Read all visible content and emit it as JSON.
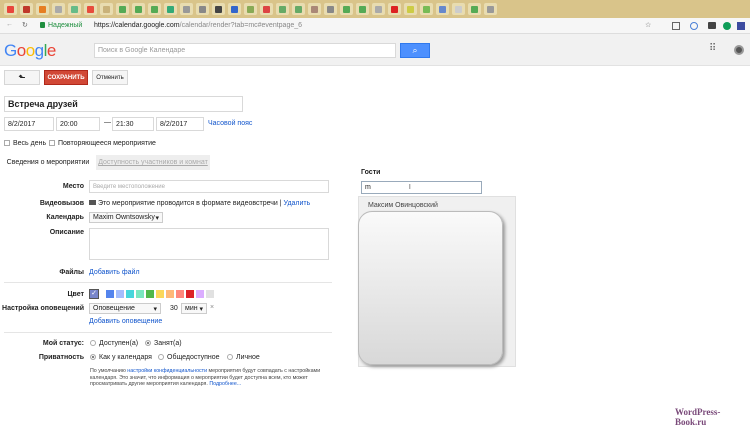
{
  "browser": {
    "secure_label": "Надежный",
    "url_host": "https://calendar.google.com",
    "url_path": "/calendar/render?tab=mc#eventpage_6"
  },
  "header": {
    "logo": "Google",
    "search_placeholder": "Поиск в Google Календаре"
  },
  "toolbar": {
    "back": "⬑",
    "save": "СОХРАНИТЬ",
    "cancel": "Отменить"
  },
  "event": {
    "title": "Встреча друзей",
    "start_date": "8/2/2017",
    "start_time": "20:00",
    "dash": "—",
    "end_time": "21:30",
    "end_date": "8/2/2017",
    "timezone_link": "Часовой пояс",
    "all_day": "Весь день",
    "repeat": "Повторяющееся мероприятие"
  },
  "tabs": [
    {
      "label": "Сведения о мероприятии"
    },
    {
      "label": "Доступность участников и комнат"
    }
  ],
  "form": {
    "place_label": "Место",
    "place_placeholder": "Введите местоположение",
    "video_label": "Видеовызов",
    "video_text": "Это мероприятие проводится в формате видеовстречи",
    "video_remove": "Удалить",
    "calendar_label": "Календарь",
    "calendar_value": "Maxim Owntsowsky",
    "description_label": "Описание",
    "files_label": "Файлы",
    "files_link": "Добавить файл",
    "color_label": "Цвет",
    "colors": [
      "#7986cb",
      "#5484ed",
      "#a4bdfc",
      "#46d6db",
      "#7ae7bf",
      "#51b749",
      "#fbd75b",
      "#ffb878",
      "#ff887c",
      "#dc2127",
      "#dbadff",
      "#e1e1e1"
    ],
    "notify_label": "Настройка оповещений",
    "notify_type": "Оповещение",
    "notify_value": "30",
    "notify_unit": "мин",
    "notify_add": "Добавить оповещение",
    "status_label": "Мой статус:",
    "status_options": [
      "Доступен(а)",
      "Занят(а)"
    ],
    "privacy_label": "Приватность",
    "privacy_options": [
      "Как у календаря",
      "Общедоступное",
      "Личное"
    ],
    "note_pre": "По умолчанию ",
    "note_link": "настройки конфиденциальности",
    "note_post": " мероприятия будут совпадать с настройками календаря. Это значит, что информация о мероприятии будет доступна всем, кто может просматривать другие мероприятия календаря. ",
    "note_more": "Подробнее..."
  },
  "guests": {
    "label": "Гости",
    "input_value": "m",
    "suggestion": "Максим Овинцовский"
  },
  "watermark": "WordPress-Book.ru"
}
